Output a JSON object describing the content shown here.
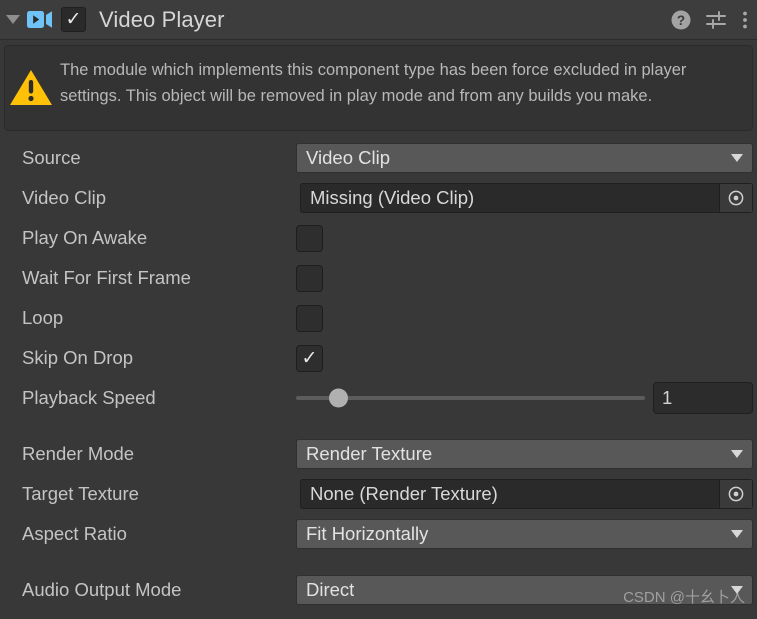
{
  "header": {
    "foldout_icon": "triangle-down-icon",
    "component_icon": "video-player-icon",
    "enabled": true,
    "checkmark": "✓",
    "title": "Video Player",
    "icons": [
      {
        "name": "help-icon",
        "label": "?"
      },
      {
        "name": "preset-icon",
        "label": ""
      },
      {
        "name": "more-menu-icon",
        "label": "⋮"
      }
    ]
  },
  "help_box": {
    "icon": "warning-icon",
    "message": "The module which implements this component type has been force excluded in player settings. This object will be removed in play mode and from any builds you make.",
    "color": "#FFC107"
  },
  "properties": {
    "source": {
      "label": "Source",
      "value": "Video Clip",
      "type": "enum"
    },
    "video_clip": {
      "label": "Video Clip",
      "value": "Missing (Video Clip)",
      "type": "object"
    },
    "play_on_awake": {
      "label": "Play On Awake",
      "value": false,
      "type": "toggle"
    },
    "wait_for_first_frame": {
      "label": "Wait For First Frame",
      "value": false,
      "type": "toggle"
    },
    "loop": {
      "label": "Loop",
      "value": false,
      "type": "toggle"
    },
    "skip_on_drop": {
      "label": "Skip On Drop",
      "value": true,
      "checkmark": "✓",
      "type": "toggle"
    },
    "playback_speed": {
      "label": "Playback Speed",
      "value": "1",
      "type": "slider",
      "fill_percent": 12,
      "min": "0",
      "max": "10"
    },
    "render_mode": {
      "label": "Render Mode",
      "value": "Render Texture",
      "type": "enum"
    },
    "target_texture": {
      "label": "Target Texture",
      "value": "None (Render Texture)",
      "type": "object"
    },
    "aspect_ratio": {
      "label": "Aspect Ratio",
      "value": "Fit Horizontally",
      "type": "enum"
    },
    "audio_output_mode": {
      "label": "Audio Output Mode",
      "value": "Direct",
      "type": "enum"
    }
  },
  "watermark": {
    "text": "CSDN @十幺卜人"
  },
  "colors": {
    "background": "#383838",
    "header": "#3d3d3d",
    "enum_field": "#585858",
    "object_field": "#2a2a2a",
    "accent_icon": "#6FC3F7",
    "warning": "#FFC107"
  }
}
